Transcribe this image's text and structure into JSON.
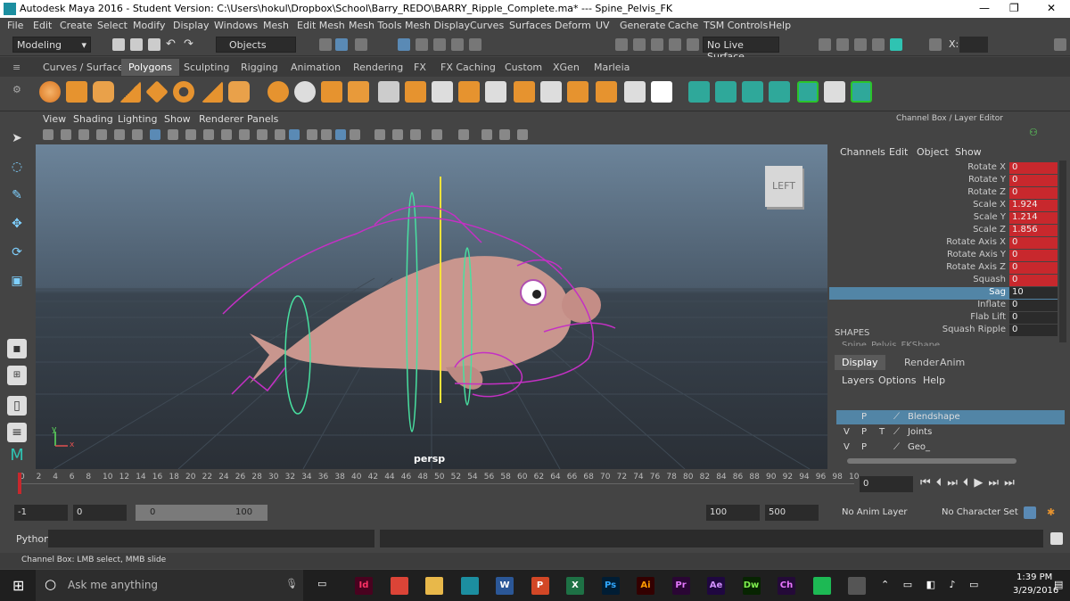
{
  "window": {
    "title": "Autodesk Maya 2016 - Student Version: C:\\Users\\hokul\\Dropbox\\School\\Barry_REDO\\BARRY_Ripple_Complete.ma*   ---   Spine_Pelvis_FK",
    "minimize": "—",
    "maximize": "❐",
    "close": "✕"
  },
  "menus": [
    "File",
    "Edit",
    "Create",
    "Select",
    "Modify",
    "Display",
    "Windows",
    "Mesh",
    "Edit Mesh",
    "Mesh Tools",
    "Mesh Display",
    "Curves",
    "Surfaces",
    "Deform",
    "UV",
    "Generate",
    "Cache",
    "TSM Controls",
    "Help"
  ],
  "status": {
    "mode": "Modeling",
    "selection_mask": "Objects",
    "live_surface": "No Live Surface",
    "x_label": "X:"
  },
  "shelf_tabs": [
    "Curves / Surfaces",
    "Polygons",
    "Sculpting",
    "Rigging",
    "Animation",
    "Rendering",
    "FX",
    "FX Caching",
    "Custom",
    "XGen",
    "Marleia"
  ],
  "active_shelf": "Polygons",
  "viewport": {
    "menus": [
      "View",
      "Shading",
      "Lighting",
      "Show",
      "Renderer",
      "Panels"
    ],
    "camera_label": "persp",
    "view_cube": "LEFT",
    "axis_x": "x",
    "axis_y": "y"
  },
  "channel_box": {
    "header": "Channel Box / Layer Editor",
    "menus": [
      "Channels",
      "Edit",
      "Object",
      "Show"
    ],
    "channels": [
      {
        "name": "Rotate X",
        "value": "0",
        "keyed": true
      },
      {
        "name": "Rotate Y",
        "value": "0",
        "keyed": true
      },
      {
        "name": "Rotate Z",
        "value": "0",
        "keyed": true
      },
      {
        "name": "Scale X",
        "value": "1.924",
        "keyed": true
      },
      {
        "name": "Scale Y",
        "value": "1.214",
        "keyed": true
      },
      {
        "name": "Scale Z",
        "value": "1.856",
        "keyed": true
      },
      {
        "name": "Rotate Axis X",
        "value": "0",
        "keyed": true
      },
      {
        "name": "Rotate Axis Y",
        "value": "0",
        "keyed": true
      },
      {
        "name": "Rotate Axis Z",
        "value": "0",
        "keyed": true
      },
      {
        "name": "Squash",
        "value": "0",
        "keyed": true
      },
      {
        "name": "Sag",
        "value": "10",
        "keyed": false,
        "selected": true
      },
      {
        "name": "Inflate",
        "value": "0",
        "keyed": false
      },
      {
        "name": "Flab Lift",
        "value": "0",
        "keyed": false
      },
      {
        "name": "Squash Ripple",
        "value": "0",
        "keyed": false
      }
    ],
    "shapes_label": "SHAPES",
    "shape_name": "Spine_Pelvis_FKShape"
  },
  "layer_editor": {
    "tabs": [
      "Display",
      "Render",
      "Anim"
    ],
    "menus": [
      "Layers",
      "Options",
      "Help"
    ],
    "layers": [
      {
        "v": "",
        "p": "P",
        "t": "",
        "name": "Blendshape",
        "selected": true
      },
      {
        "v": "V",
        "p": "P",
        "t": "T",
        "name": "Joints",
        "selected": false
      },
      {
        "v": "V",
        "p": "P",
        "t": "",
        "name": "Geo_",
        "selected": false
      }
    ]
  },
  "timeline": {
    "ticks": [
      "0",
      "2",
      "4",
      "6",
      "8",
      "10",
      "12",
      "14",
      "16",
      "18",
      "20",
      "22",
      "24",
      "26",
      "28",
      "30",
      "32",
      "34",
      "36",
      "38",
      "40",
      "42",
      "44",
      "46",
      "48",
      "50",
      "52",
      "54",
      "56",
      "58",
      "60",
      "62",
      "64",
      "66",
      "68",
      "70",
      "72",
      "74",
      "76",
      "78",
      "80",
      "82",
      "84",
      "86",
      "88",
      "90",
      "92",
      "94",
      "96",
      "98",
      "10"
    ],
    "current_frame": "0"
  },
  "range": {
    "start": "-1",
    "anim_start": "0",
    "range_start": "0",
    "range_end": "100",
    "anim_end": "100",
    "end": "500",
    "anim_layer": "No Anim Layer",
    "character_set": "No Character Set"
  },
  "command": {
    "lang": "Python"
  },
  "help_line": "Channel Box: LMB select, MMB slide",
  "taskbar": {
    "search": "Ask me anything",
    "time": "1:39 PM",
    "date": "3/29/2016",
    "apps": [
      {
        "label": "Id",
        "color": "#49021f",
        "fg": "#ff3366"
      },
      {
        "label": "",
        "color": "#db4437",
        "fg": "#fff"
      },
      {
        "label": "",
        "color": "#e8b84a",
        "fg": "#fff"
      },
      {
        "label": "",
        "color": "#1c8ea0",
        "fg": "#fff"
      },
      {
        "label": "W",
        "color": "#2b5797",
        "fg": "#fff"
      },
      {
        "label": "P",
        "color": "#d24726",
        "fg": "#fff"
      },
      {
        "label": "X",
        "color": "#1e7145",
        "fg": "#fff"
      },
      {
        "label": "Ps",
        "color": "#001d34",
        "fg": "#31a8ff"
      },
      {
        "label": "Ai",
        "color": "#330000",
        "fg": "#ff9a00"
      },
      {
        "label": "Pr",
        "color": "#2a0634",
        "fg": "#e579ff"
      },
      {
        "label": "Ae",
        "color": "#1f0740",
        "fg": "#d291ff"
      },
      {
        "label": "Dw",
        "color": "#072401",
        "fg": "#7ff04f"
      },
      {
        "label": "Ch",
        "color": "#240a38",
        "fg": "#ea77ff"
      },
      {
        "label": "",
        "color": "#1db954",
        "fg": "#fff"
      },
      {
        "label": "",
        "color": "#555",
        "fg": "#fff"
      }
    ]
  }
}
